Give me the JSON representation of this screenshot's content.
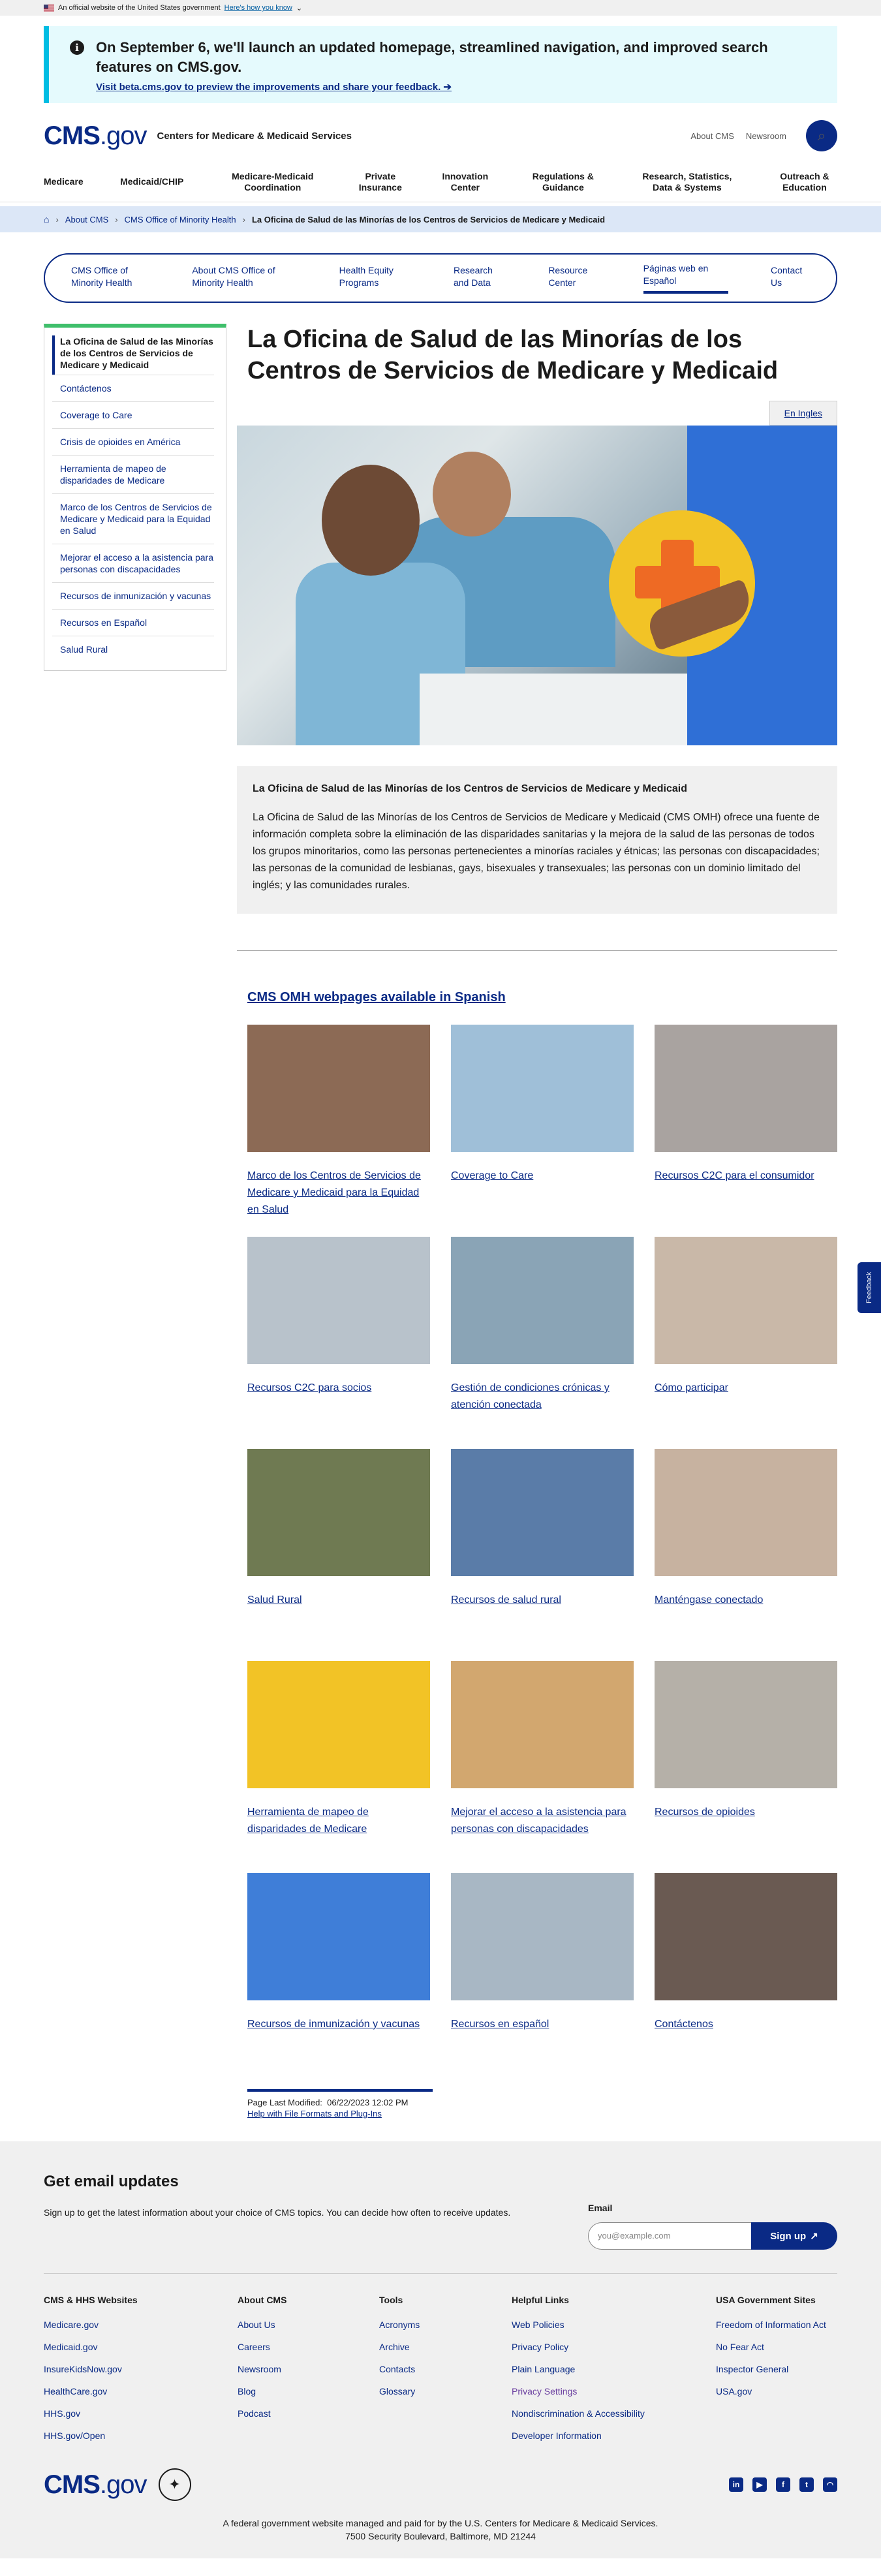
{
  "gov_banner": {
    "text": "An official website of the United States government",
    "how": "Here's how you know"
  },
  "alert": {
    "message": "On September 6, we'll launch an updated homepage, streamlined navigation, and improved search features on CMS.gov.",
    "link": "Visit beta.cms.gov to preview the improvements and share your feedback. ➔"
  },
  "header": {
    "logo_main": "CMS",
    "logo_gov": ".gov",
    "tagline": "Centers for Medicare & Medicaid Services",
    "about": "About CMS",
    "newsroom": "Newsroom"
  },
  "mainnav": [
    "Medicare",
    "Medicaid/CHIP",
    "Medicare-Medicaid Coordination",
    "Private Insurance",
    "Innovation Center",
    "Regulations & Guidance",
    "Research, Statistics, Data & Systems",
    "Outreach & Education"
  ],
  "breadcrumb": {
    "about": "About CMS",
    "omh": "CMS Office of Minority Health",
    "current": "La Oficina de Salud de las Minorías de los Centros de Servicios de Medicare y Medicaid"
  },
  "subnav": [
    "CMS Office of Minority Health",
    "About CMS Office of Minority Health",
    "Health Equity Programs",
    "Research and Data",
    "Resource Center",
    "Páginas web en Español",
    "Contact Us"
  ],
  "sidebar": {
    "current": "La Oficina de Salud de las Minorías de los Centros de Servicios de Medicare y Medicaid",
    "items": [
      "Contáctenos",
      "Coverage to Care",
      "Crisis de opioides en América",
      "Herramienta de mapeo de disparidades de Medicare",
      "Marco de los Centros de Servicios de Medicare y Medicaid para la Equidad en Salud",
      "Mejorar el acceso a la asistencia para personas con discapacidades",
      "Recursos de inmunización y vacunas",
      "Recursos en Español",
      "Salud Rural"
    ]
  },
  "page": {
    "title": "La Oficina de Salud de las Minorías de los Centros de Servicios de Medicare y Medicaid",
    "lang_button": "En Ingles",
    "intro_heading": "La Oficina de Salud de las Minorías de los Centros de Servicios de Medicare y Medicaid",
    "intro_text": "La Oficina de Salud de las Minorías de los Centros de Servicios de Medicare y Medicaid (CMS OMH) ofrece una fuente de información completa sobre la eliminación de las disparidades sanitarias y la mejora de la salud de las personas de todos los grupos minoritarios, como las personas pertenecientes a minorías raciales y étnicas; las personas con discapacidades; las personas de la comunidad de lesbianas, gays, bisexuales y transexuales; las personas con un dominio limitado del inglés; y las comunidades rurales.",
    "section_title": "CMS OMH webpages available in Spanish",
    "cards": [
      {
        "label": "Marco de los Centros de Servicios de Medicare y Medicaid para la Equidad en Salud",
        "color": "#8c6a55"
      },
      {
        "label": "Coverage to Care",
        "color": "#9fbfd8"
      },
      {
        "label": "Recursos C2C para el consumidor",
        "color": "#a9a3a0"
      },
      {
        "label": "Recursos C2C para socios",
        "color": "#b8c2cb"
      },
      {
        "label": "Gestión de condiciones crónicas y atención conectada",
        "color": "#8aa4b6"
      },
      {
        "label": "Cómo participar",
        "color": "#c9b8a8"
      },
      {
        "label": "Salud Rural",
        "color": "#6f7a52"
      },
      {
        "label": "Recursos de salud rural",
        "color": "#5a7ca8"
      },
      {
        "label": "Manténgase conectado",
        "color": "#c7b2a0"
      },
      {
        "label": "Herramienta de mapeo de disparidades de Medicare",
        "color": "#f2c326"
      },
      {
        "label": "Mejorar el acceso a la asistencia para personas con discapacidades",
        "color": "#d2a76f"
      },
      {
        "label": "Recursos de opioides",
        "color": "#b5b0a8"
      },
      {
        "label": "Recursos de inmunización y vacunas",
        "color": "#3f7ed8"
      },
      {
        "label": "Recursos en español",
        "color": "#a8b7c4"
      },
      {
        "label": "Contáctenos",
        "color": "#6a5a52"
      }
    ],
    "modified_label": "Page Last Modified:",
    "modified_value": "06/22/2023 12:02 PM",
    "help_link": "Help with File Formats and Plug-Ins"
  },
  "footer": {
    "email_title": "Get email updates",
    "email_desc": "Sign up to get the latest information about your choice of CMS topics. You can decide how often to receive updates.",
    "email_label": "Email",
    "email_placeholder": "you@example.com",
    "signup": "Sign up",
    "columns": [
      {
        "title": "CMS & HHS Websites",
        "links": [
          "Medicare.gov",
          "Medicaid.gov",
          "InsureKidsNow.gov",
          "HealthCare.gov",
          "HHS.gov",
          "HHS.gov/Open"
        ]
      },
      {
        "title": "About CMS",
        "links": [
          "About Us",
          "Careers",
          "Newsroom",
          "Blog",
          "Podcast"
        ]
      },
      {
        "title": "Tools",
        "links": [
          "Acronyms",
          "Archive",
          "Contacts",
          "Glossary"
        ]
      },
      {
        "title": "Helpful Links",
        "links": [
          "Web Policies",
          "Privacy Policy",
          "Plain Language",
          "Privacy Settings",
          "Nondiscrimination & Accessibility",
          "Developer Information"
        ]
      },
      {
        "title": "USA Government Sites",
        "links": [
          "Freedom of Information Act",
          "No Fear Act",
          "Inspector General",
          "USA.gov"
        ]
      }
    ],
    "note1": "A federal government website managed and paid for by the U.S. Centers for Medicare & Medicaid Services.",
    "note2": "7500 Security Boulevard, Baltimore, MD 21244"
  },
  "feedback": "Feedback"
}
